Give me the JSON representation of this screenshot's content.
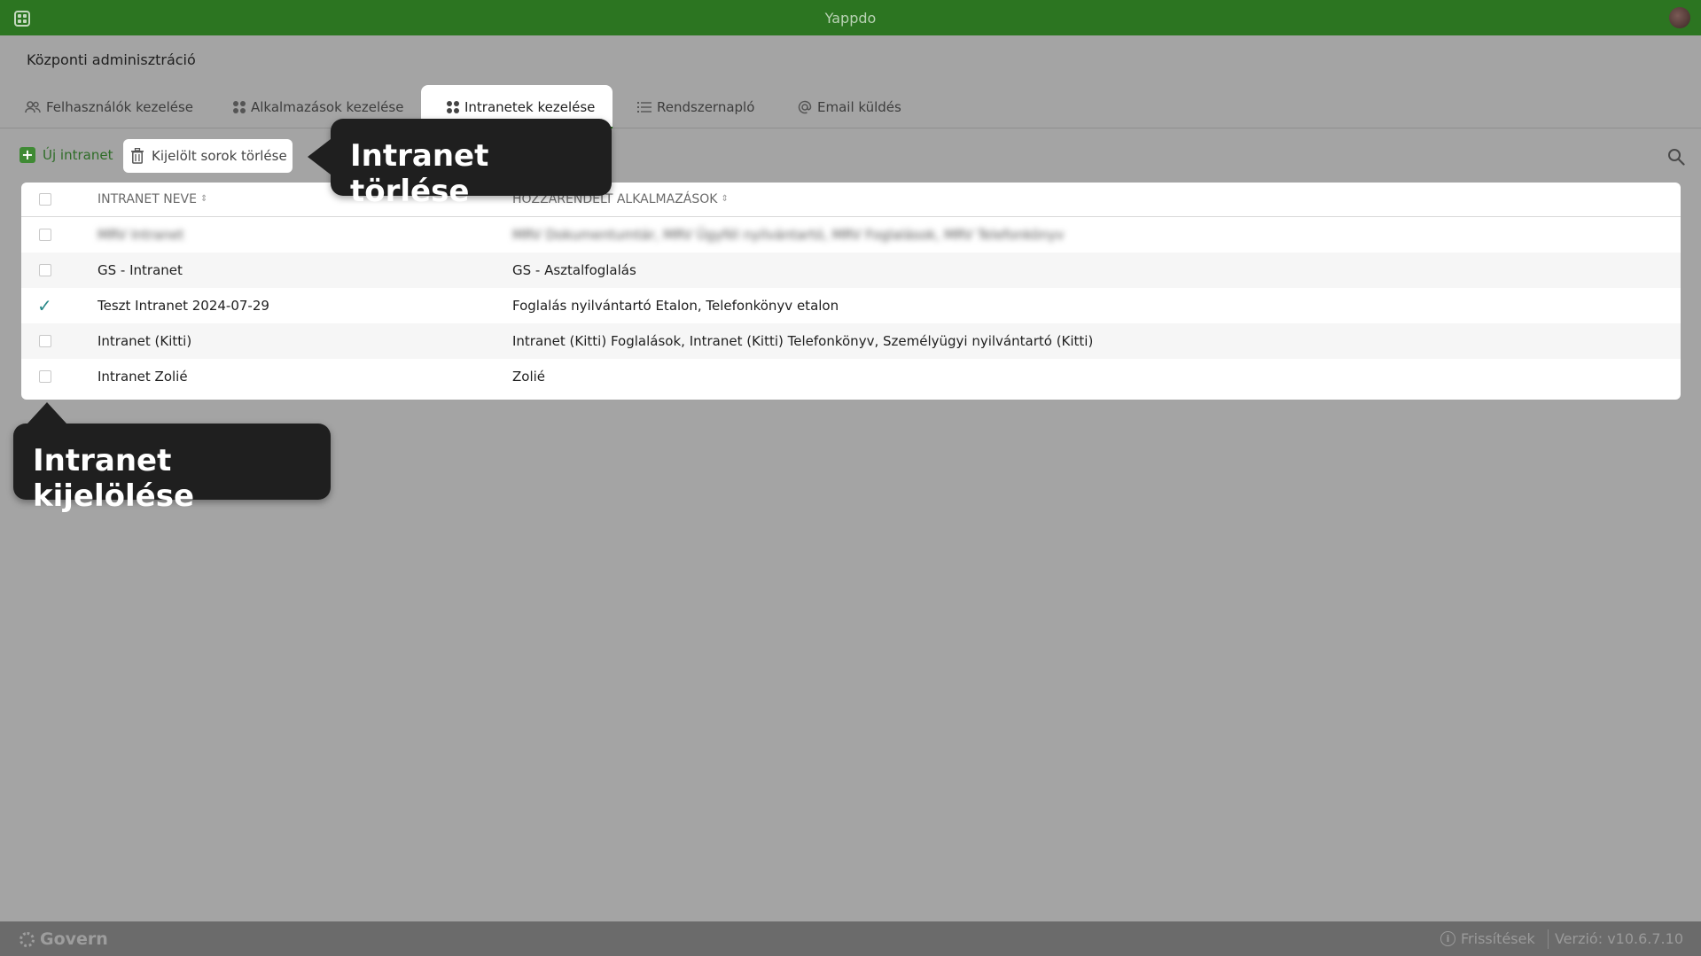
{
  "app": {
    "title": "Yappdo"
  },
  "page": {
    "title": "Központi adminisztráció"
  },
  "tabs": [
    {
      "label": "Felhasználók kezelése",
      "icon": "users-icon"
    },
    {
      "label": "Alkalmazások kezelése",
      "icon": "apps-icon"
    },
    {
      "label": "Intranetek kezelése",
      "icon": "apps-icon",
      "active": true
    },
    {
      "label": "Rendszernapló",
      "icon": "list-icon"
    },
    {
      "label": "Email küldés",
      "icon": "at-icon"
    }
  ],
  "toolbar": {
    "new_label": "Új intranet",
    "delete_label": "Kijelölt sorok törlése"
  },
  "table": {
    "columns": [
      "INTRANET NEVE",
      "HOZZÁRENDELT ALKALMAZÁSOK"
    ],
    "rows": [
      {
        "name": "MRV Intranet",
        "apps": "MRV Dokumentumtár, MRV Ügyfél nyilvántartó, MRV Foglalások, MRV Telefonkönyv",
        "blurred": true,
        "checked": false
      },
      {
        "name": "GS - Intranet",
        "apps": "GS - Asztalfoglalás",
        "checked": false
      },
      {
        "name": "Teszt Intranet 2024-07-29",
        "apps": "Foglalás nyilvántartó Etalon, Telefonkönyv etalon",
        "checked": true
      },
      {
        "name": "Intranet (Kitti)",
        "apps": "Intranet (Kitti) Foglalások, Intranet (Kitti) Telefonkönyv, Személyügyi nyilvántartó (Kitti)",
        "checked": false
      },
      {
        "name": "Intranet Zolié",
        "apps": "Zolié",
        "checked": false
      }
    ]
  },
  "callouts": {
    "delete": "Intranet törlése",
    "select": "Intranet kijelölése"
  },
  "statusbar": {
    "brand": "Govern",
    "updates": "Frissítések",
    "version": "Verzió: v10.6.7.10"
  },
  "colors": {
    "brand_green": "#2c7521",
    "overlay_gray": "#a4a4a4",
    "callout_bg": "#1f1f1f",
    "check_color": "#2b8a8a"
  }
}
